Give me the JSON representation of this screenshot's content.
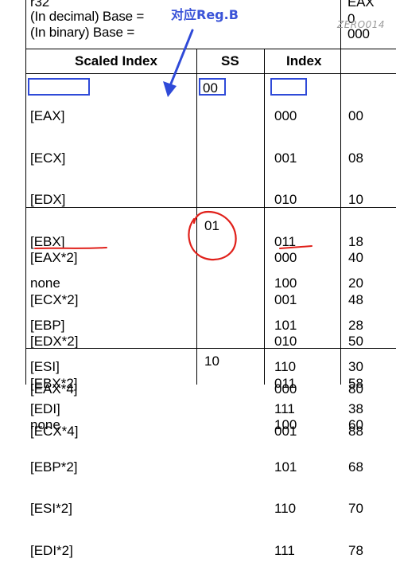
{
  "top": {
    "line1": "r32",
    "line2": "(In decimal) Base =",
    "line3": "(In binary) Base =",
    "right1": "EAX",
    "right2": "0",
    "right3": "000",
    "annotation": "对应Reg.B",
    "watermark": "ZERO014"
  },
  "headers": {
    "scaled_index": "Scaled Index",
    "ss": "SS",
    "index": "Index"
  },
  "groups": [
    {
      "scaled": [
        "[EAX]",
        "[ECX]",
        "[EDX]",
        "[EBX]",
        "none",
        "[EBP]",
        "[ESI]",
        "[EDI]"
      ],
      "ss": "00",
      "index": [
        "000",
        "001",
        "010",
        "011",
        "100",
        "101",
        "110",
        "111"
      ],
      "values": [
        "00",
        "08",
        "10",
        "18",
        "20",
        "28",
        "30",
        "38"
      ]
    },
    {
      "scaled": [
        "[EAX*2]",
        "[ECX*2]",
        "[EDX*2]",
        "[EBX*2]",
        "none",
        "[EBP*2]",
        "[ESI*2]",
        "[EDI*2]"
      ],
      "ss": "01",
      "index": [
        "000",
        "001",
        "010",
        "011",
        "100",
        "101",
        "110",
        "111"
      ],
      "values": [
        "40",
        "48",
        "50",
        "58",
        "60",
        "68",
        "70",
        "78"
      ]
    },
    {
      "scaled": [
        "[EAX*4]",
        "[ECX*4]"
      ],
      "ss": "10",
      "index": [
        "000",
        "001"
      ],
      "values": [
        "80",
        "88"
      ]
    }
  ],
  "colors": {
    "annotation_blue": "#3a53d8",
    "annotation_red": "#e0201a"
  }
}
